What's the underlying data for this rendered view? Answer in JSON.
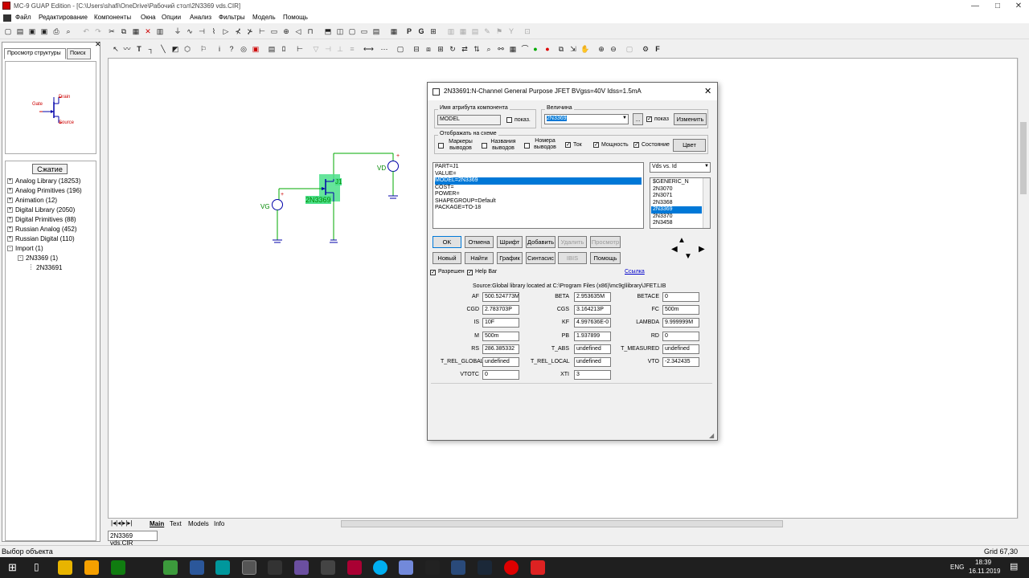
{
  "window": {
    "title": "MC-9 GUAP Edition - [C:\\Users\\shafi\\OneDrive\\Рабочий стол\\2N3369 vds.CIR]",
    "min": "—",
    "max": "□",
    "close": "✕"
  },
  "menu": [
    "Файл",
    "Редактирование",
    "Компоненты",
    "Окна",
    "Опции",
    "Анализ",
    "Фильтры",
    "Модель",
    "Помощь"
  ],
  "left": {
    "tab_structure": "Просмотр структуры",
    "tab_search": "Поиск",
    "compress": "Сжатие",
    "preview": {
      "drain": "Drain",
      "gate": "Gate",
      "source": "Source"
    },
    "tree": [
      {
        "pm": "+",
        "label": "Analog Library (18253)"
      },
      {
        "pm": "+",
        "label": "Analog Primitives (196)"
      },
      {
        "pm": "+",
        "label": "Animation (12)"
      },
      {
        "pm": "+",
        "label": "Digital Library (2050)"
      },
      {
        "pm": "+",
        "label": "Digital Primitives (88)"
      },
      {
        "pm": "+",
        "label": "Russian Analog (452)"
      },
      {
        "pm": "+",
        "label": "Russian Digital (110)"
      },
      {
        "pm": "-",
        "label": "Import (1)"
      },
      {
        "pm": "-",
        "label": "2N3369 (1)"
      },
      {
        "pm": "",
        "label": "2N33691"
      }
    ]
  },
  "schematic": {
    "vd": "VD",
    "vg": "VG",
    "j1": "J1",
    "part": "2N3369",
    "plus": "+"
  },
  "sheet_tabs": [
    "Main",
    "Text",
    "Models",
    "Info"
  ],
  "doc_tab": "2N3369 vds.CIR",
  "status": {
    "left": "Выбор объекта",
    "right": "Grid 67,30"
  },
  "dialog": {
    "title": "2N33691:N-Channel General Purpose JFET BVgss=40V Idss=1.5mA",
    "attr_group": "Имя атрибута компонента",
    "attr_value": "MODEL",
    "show1": "показ.",
    "value_group": "Величина",
    "value": "2N3369",
    "dots": "...",
    "show2": "показ",
    "change": "Изменить",
    "display_group": "Отображать на схеме",
    "opt_markers": "Маркеры выводов",
    "opt_names": "Названия выводов",
    "opt_numbers": "Номера выводов",
    "opt_current": "Ток",
    "opt_power": "Мощность",
    "opt_state": "Состояние",
    "color": "Цвет",
    "attrs": [
      "PART=J1",
      "VALUE=",
      "MODEL=2N3369",
      "COST=",
      "POWER=",
      "SHAPEGROUP=Default",
      "PACKAGE=TO-18"
    ],
    "plot_select": "Vds vs. Id",
    "models": [
      "$GENERIC_N",
      "2N3070",
      "2N3071",
      "2N3368",
      "2N3369",
      "2N3370",
      "2N3458"
    ],
    "btns1": [
      "OK",
      "Отмена",
      "Шрифт",
      "Добавить",
      "Удалить",
      "Просмотр"
    ],
    "btns2": [
      "Новый",
      "Найти",
      "График",
      "Синтасис",
      "IBIS",
      "Помощь"
    ],
    "enable": "Разрешен",
    "helpbar": "Help Bar",
    "link": "Ссылка",
    "source": "Source:Global library located at C:\\Program Files (x86)\\mc9g\\library\\JFET.LIB",
    "params": [
      [
        "AF",
        "500.524773M",
        "BETA",
        "2.953635M",
        "BETACE",
        "0"
      ],
      [
        "CGD",
        "2.783703P",
        "CGS",
        "3.164213P",
        "FC",
        "500m"
      ],
      [
        "IS",
        "10F",
        "KF",
        "4.997636E-0",
        "LAMBDA",
        "9.999999M"
      ],
      [
        "M",
        "500m",
        "PB",
        "1.937899",
        "RD",
        "0"
      ],
      [
        "RS",
        "286.385332",
        "T_ABS",
        "undefined",
        "T_MEASURED",
        "undefined"
      ],
      [
        "T_REL_GLOBAL",
        "undefined",
        "T_REL_LOCAL",
        "undefined",
        "VTO",
        "-2.342435"
      ],
      [
        "VTOTC",
        "0",
        "XTI",
        "3",
        "",
        ""
      ]
    ]
  },
  "taskbar": {
    "lang": "ENG",
    "time": "18:39",
    "date": "16.11.2019"
  }
}
